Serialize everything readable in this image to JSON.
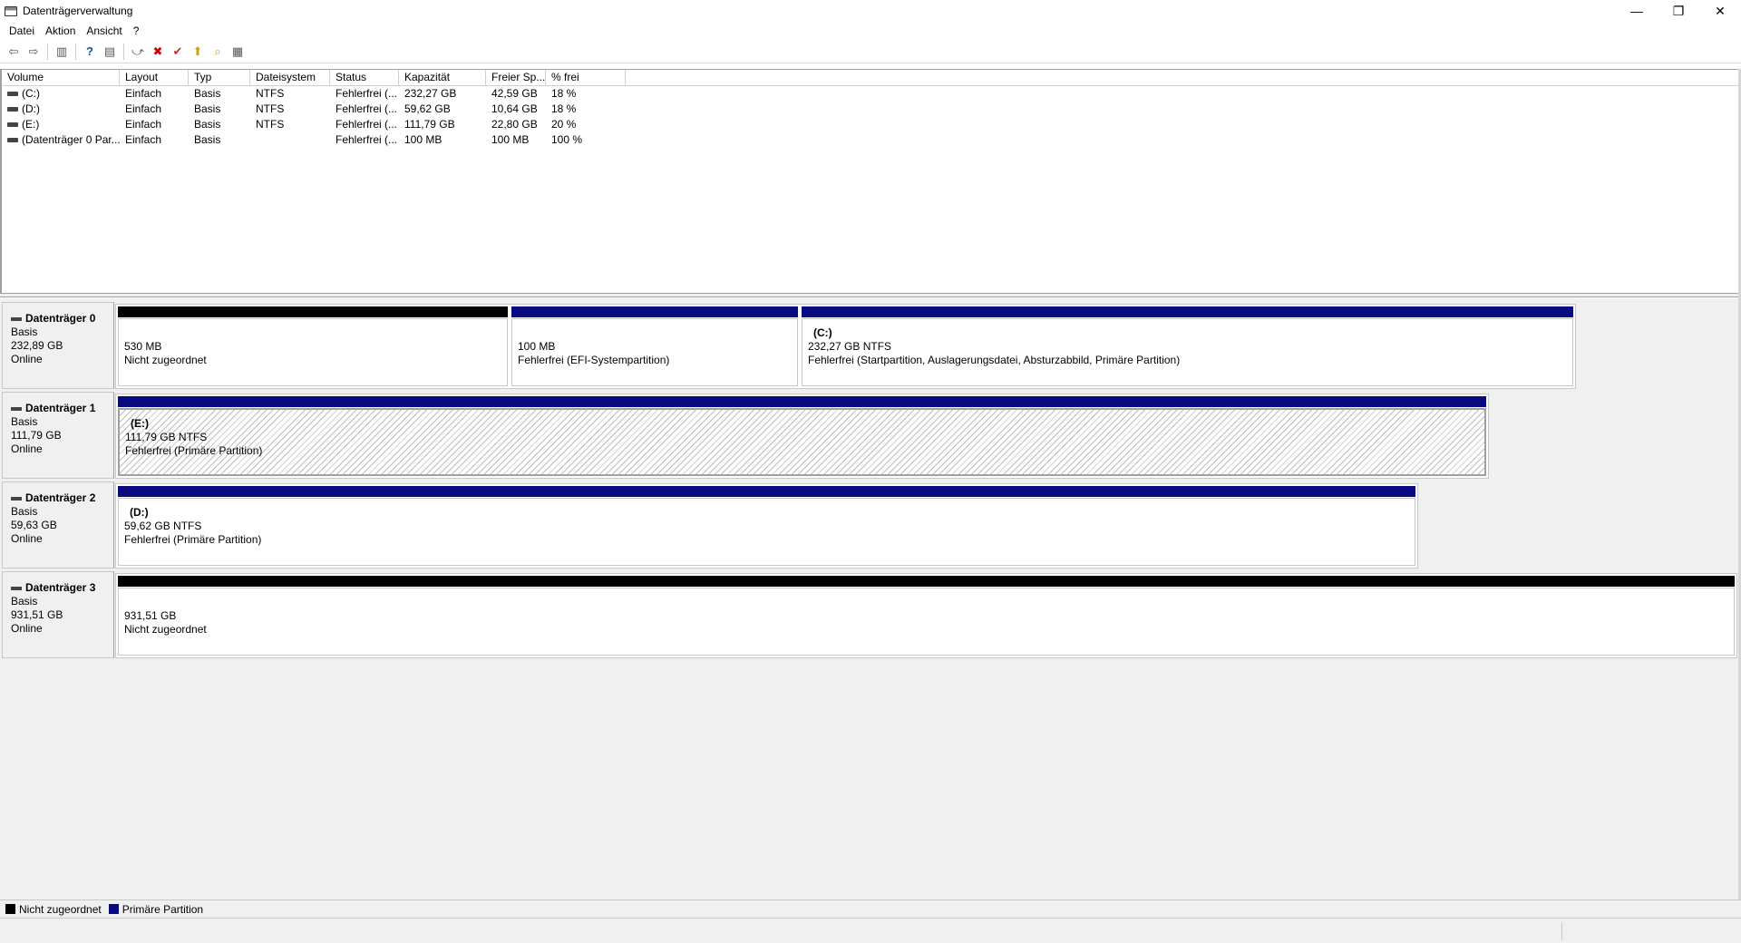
{
  "window": {
    "title": "Datenträgerverwaltung",
    "controls": [
      "—",
      "❐",
      "✕"
    ]
  },
  "menu": [
    "Datei",
    "Aktion",
    "Ansicht",
    "?"
  ],
  "toolbar": {
    "icons": [
      "back-arrow-icon",
      "forward-arrow-icon",
      "show-hide-console-tree-icon",
      "help-icon",
      "properties-icon",
      "connect-icon",
      "delete-icon",
      "checkmark-icon",
      "folder-up-icon",
      "search-folder-icon",
      "view-list-icon"
    ],
    "glyphs": [
      "⇦",
      "⇨",
      "▥",
      "?",
      "▤",
      "⤻",
      "✖",
      "✔",
      "⬆",
      "⌕",
      "▦"
    ]
  },
  "volume_list": {
    "columns": [
      "Volume",
      "Layout",
      "Typ",
      "Dateisystem",
      "Status",
      "Kapazität",
      "Freier Sp...",
      "% frei"
    ],
    "rows": [
      [
        "(C:)",
        "Einfach",
        "Basis",
        "NTFS",
        "Fehlerfrei (...",
        "232,27 GB",
        "42,59 GB",
        "18 %"
      ],
      [
        "(D:)",
        "Einfach",
        "Basis",
        "NTFS",
        "Fehlerfrei (...",
        "59,62 GB",
        "10,64 GB",
        "18 %"
      ],
      [
        "(E:)",
        "Einfach",
        "Basis",
        "NTFS",
        "Fehlerfrei (...",
        "111,79 GB",
        "22,80 GB",
        "20 %"
      ],
      [
        "(Datenträger 0 Par...",
        "Einfach",
        "Basis",
        "",
        "Fehlerfrei (...",
        "100 MB",
        "100 MB",
        "100 %"
      ]
    ]
  },
  "disks": [
    {
      "name": "Datenträger 0",
      "type": "Basis",
      "size": "232,89 GB",
      "state": "Online",
      "partitions": [
        {
          "kind": "unallocated",
          "title": "",
          "line1": "530 MB",
          "line2": "Nicht zugeordnet"
        },
        {
          "kind": "primary",
          "title": "",
          "line1": "100 MB",
          "line2": "Fehlerfrei (EFI-Systempartition)"
        },
        {
          "kind": "primary",
          "title": "(C:)",
          "line1": "232,27 GB NTFS",
          "line2": "Fehlerfrei (Startpartition, Auslagerungsdatei, Absturzabbild, Primäre Partition)"
        }
      ]
    },
    {
      "name": "Datenträger 1",
      "type": "Basis",
      "size": "111,79 GB",
      "state": "Online",
      "partitions": [
        {
          "kind": "primary-selected",
          "title": "(E:)",
          "line1": "111,79 GB NTFS",
          "line2": "Fehlerfrei (Primäre Partition)"
        }
      ]
    },
    {
      "name": "Datenträger 2",
      "type": "Basis",
      "size": "59,63 GB",
      "state": "Online",
      "partitions": [
        {
          "kind": "primary",
          "title": "(D:)",
          "line1": "59,62 GB NTFS",
          "line2": "Fehlerfrei (Primäre Partition)"
        }
      ]
    },
    {
      "name": "Datenträger 3",
      "type": "Basis",
      "size": "931,51 GB",
      "state": "Online",
      "partitions": [
        {
          "kind": "unallocated",
          "title": "",
          "line1": "931,51 GB",
          "line2": "Nicht zugeordnet"
        }
      ]
    }
  ],
  "legend": [
    {
      "label": "Nicht zugeordnet",
      "color": "#000000"
    },
    {
      "label": "Primäre Partition",
      "color": "#0a0a80"
    }
  ]
}
